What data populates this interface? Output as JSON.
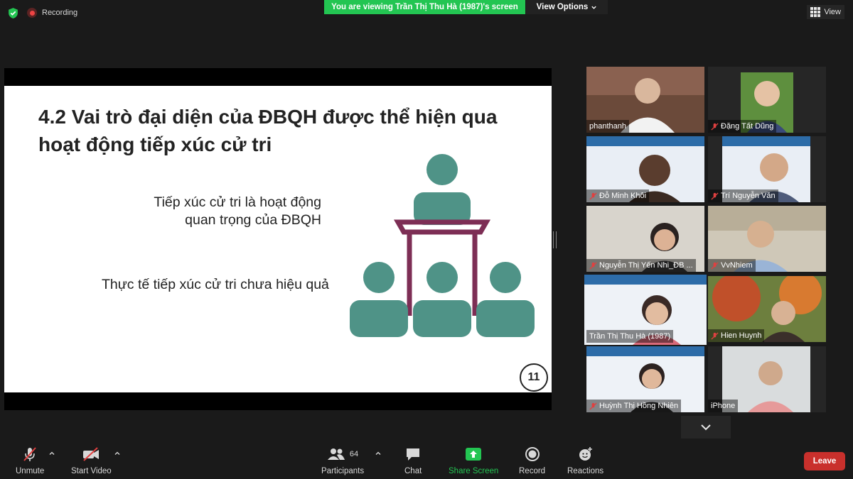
{
  "top_bar": {
    "recording_label": "Recording",
    "viewing_banner": "You are viewing Trần Thị Thu Hà (1987)'s screen",
    "view_options_label": "View Options",
    "view_label": "View"
  },
  "slide": {
    "title": "4.2 Vai trò đại diện của ĐBQH được thể hiện qua hoạt động tiếp xúc cử tri",
    "bullet_1_line_1": "Tiếp xúc cử tri là hoạt động",
    "bullet_1_line_2": "quan trọng của ĐBQH",
    "bullet_2": "Thực tế tiếp xúc cử tri chưa hiệu quả",
    "page_number": "11"
  },
  "participants": [
    {
      "name": "phanthanh",
      "muted": false
    },
    {
      "name": "Đặng Tất Dũng",
      "muted": true
    },
    {
      "name": "Đỗ Minh Khôi",
      "muted": true
    },
    {
      "name": "Trí Nguyễn Văn",
      "muted": true
    },
    {
      "name": "Nguyễn Thị Yến Nhi_ĐB ...",
      "muted": true
    },
    {
      "name": "VvNhiem",
      "muted": true
    },
    {
      "name": "Trần Thị Thu Hà (1987)",
      "muted": false
    },
    {
      "name": "Hien Huynh",
      "muted": true
    },
    {
      "name": "Huỳnh Thị Hồng Nhiên",
      "muted": true
    },
    {
      "name": "iPhone",
      "muted": false
    }
  ],
  "toolbar": {
    "unmute_label": "Unmute",
    "start_video_label": "Start Video",
    "participants_label": "Participants",
    "participants_count": "64",
    "chat_label": "Chat",
    "share_screen_label": "Share Screen",
    "record_label": "Record",
    "reactions_label": "Reactions",
    "leave_label": "Leave"
  },
  "colors": {
    "accent_green": "#23c552",
    "leave_red": "#c9302c",
    "slide_teal": "#4f9387",
    "slide_podium": "#7d2e55",
    "active_speaker": "#e8e84a"
  }
}
